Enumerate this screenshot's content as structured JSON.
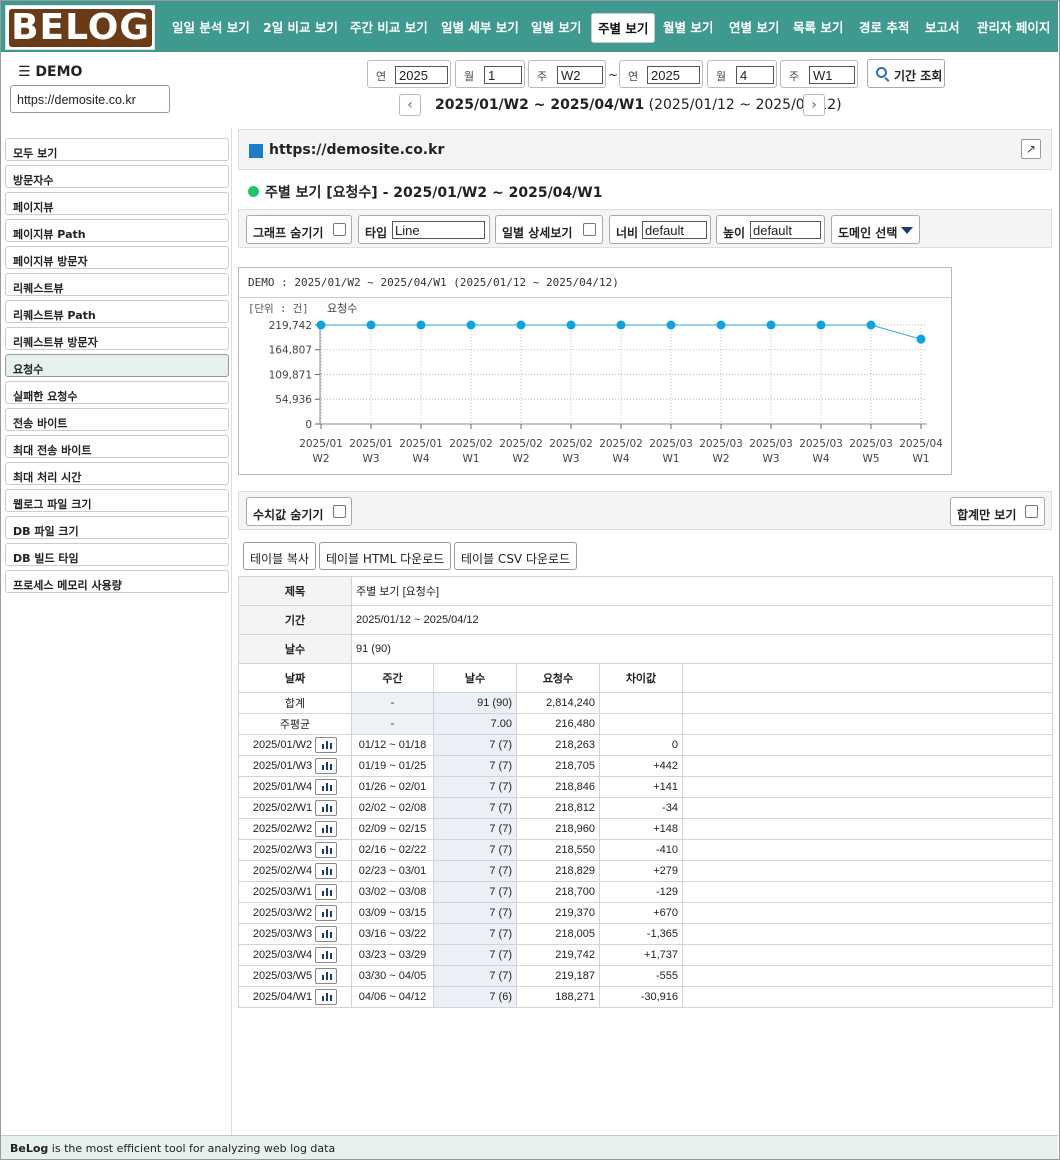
{
  "brand": "BELOG",
  "nav": [
    "일일 분석 보기",
    "2일 비교 보기",
    "주간 비교 보기",
    "일별 세부 보기",
    "일별 보기",
    "주별 보기",
    "월별 보기",
    "연별 보기",
    "목록 보기",
    "경로 추적",
    "보고서",
    "관리자 페이지"
  ],
  "nav_active": "주별 보기",
  "menu_title": "☰ DEMO",
  "site": "https://demosite.co.kr",
  "period": {
    "from_year_label": "연",
    "from_year": "2025",
    "from_month_label": "월",
    "from_month": "1",
    "from_week_label": "주",
    "from_week": "W2",
    "tilde": "~",
    "to_year_label": "연",
    "to_year": "2025",
    "to_month_label": "월",
    "to_month": "4",
    "to_week_label": "주",
    "to_week": "W1",
    "search_label": "기간 조회",
    "prev": "‹",
    "next": "›",
    "range_bold": "2025/01/W2 ~ 2025/04/W1",
    "range_dates": " (2025/01/12 ~ 2025/04/12)"
  },
  "sidebar": [
    "모두 보기",
    "방문자수",
    "페이지뷰",
    "페이지뷰 Path",
    "페이지뷰 방문자",
    "리퀘스트뷰",
    "리퀘스트뷰 Path",
    "리퀘스트뷰 방문자",
    "요청수",
    "실패한 요청수",
    "전송 바이트",
    "최대 전송 바이트",
    "최대 처리 시간",
    "웹로그 파일 크기",
    "DB 파일 크기",
    "DB 빌드 타임",
    "프로세스 메모리 사용량"
  ],
  "sidebar_active": "요청수",
  "panel_title": "https://demosite.co.kr",
  "ext_icon": "↗",
  "section_title": "주별 보기 [요청수] - 2025/01/W2 ~ 2025/04/W1",
  "options": {
    "hide_graph": "그래프 숨기기",
    "type_label": "타입",
    "type_value": "Line",
    "daily_detail": "일별 상세보기",
    "width_label": "너비",
    "width_value": "default",
    "height_label": "높이",
    "height_value": "default",
    "domain_select": "도메인 선택"
  },
  "chart_title": "DEMO : 2025/01/W2 ~ 2025/04/W1 (2025/01/12 ~ 2025/04/12)",
  "chart_data": {
    "type": "line",
    "unit_label": "[단위 : 건]",
    "series": [
      {
        "name": "요청수",
        "values": [
          219742,
          219742,
          219742,
          219742,
          219742,
          219742,
          219742,
          219742,
          219742,
          219742,
          219742,
          219742,
          188271
        ]
      }
    ],
    "categories": [
      [
        "2025/01",
        "W2"
      ],
      [
        "2025/01",
        "W3"
      ],
      [
        "2025/01",
        "W4"
      ],
      [
        "2025/02",
        "W1"
      ],
      [
        "2025/02",
        "W2"
      ],
      [
        "2025/02",
        "W3"
      ],
      [
        "2025/02",
        "W4"
      ],
      [
        "2025/03",
        "W1"
      ],
      [
        "2025/03",
        "W2"
      ],
      [
        "2025/03",
        "W3"
      ],
      [
        "2025/03",
        "W4"
      ],
      [
        "2025/03",
        "W5"
      ],
      [
        "2025/04",
        "W1"
      ]
    ],
    "yticks": [
      0,
      54936,
      109871,
      164807,
      219742
    ],
    "ytick_labels": [
      "0",
      "54,936",
      "109,871",
      "164,807",
      "219,742"
    ],
    "ylim": [
      0,
      219742
    ],
    "grid": true,
    "line_color": "#29a8df",
    "marker_color": "#0ea2df"
  },
  "table_options": {
    "hide_values": "수치값 숨기기",
    "sum_only": "합계만 보기"
  },
  "table_buttons": [
    "테이블 복사",
    "테이블 HTML 다운로드",
    "테이블 CSV 다운로드"
  ],
  "table_meta": [
    {
      "k": "제목",
      "v": "주별 보기 [요청수]"
    },
    {
      "k": "기간",
      "v": "2025/01/12 ~ 2025/04/12"
    },
    {
      "k": "날수",
      "v": "91 (90)"
    }
  ],
  "table_headers": [
    "날짜",
    "주간",
    "날수",
    "요청수",
    "차이값"
  ],
  "table_rows": [
    {
      "date": "합계",
      "week": "-",
      "days": "91 (90)",
      "count": "2,814,240",
      "diff": "",
      "summary": true
    },
    {
      "date": "주평균",
      "week": "-",
      "days": "7.00",
      "count": "216,480",
      "diff": "",
      "summary": true
    },
    {
      "date": "2025/01/W2",
      "week": "01/12 ~ 01/18",
      "days": "7 (7)",
      "count": "218,263",
      "diff": "0"
    },
    {
      "date": "2025/01/W3",
      "week": "01/19 ~ 01/25",
      "days": "7 (7)",
      "count": "218,705",
      "diff": "+442"
    },
    {
      "date": "2025/01/W4",
      "week": "01/26 ~ 02/01",
      "days": "7 (7)",
      "count": "218,846",
      "diff": "+141"
    },
    {
      "date": "2025/02/W1",
      "week": "02/02 ~ 02/08",
      "days": "7 (7)",
      "count": "218,812",
      "diff": "-34"
    },
    {
      "date": "2025/02/W2",
      "week": "02/09 ~ 02/15",
      "days": "7 (7)",
      "count": "218,960",
      "diff": "+148"
    },
    {
      "date": "2025/02/W3",
      "week": "02/16 ~ 02/22",
      "days": "7 (7)",
      "count": "218,550",
      "diff": "-410"
    },
    {
      "date": "2025/02/W4",
      "week": "02/23 ~ 03/01",
      "days": "7 (7)",
      "count": "218,829",
      "diff": "+279"
    },
    {
      "date": "2025/03/W1",
      "week": "03/02 ~ 03/08",
      "days": "7 (7)",
      "count": "218,700",
      "diff": "-129"
    },
    {
      "date": "2025/03/W2",
      "week": "03/09 ~ 03/15",
      "days": "7 (7)",
      "count": "219,370",
      "diff": "+670"
    },
    {
      "date": "2025/03/W3",
      "week": "03/16 ~ 03/22",
      "days": "7 (7)",
      "count": "218,005",
      "diff": "-1,365"
    },
    {
      "date": "2025/03/W4",
      "week": "03/23 ~ 03/29",
      "days": "7 (7)",
      "count": "219,742",
      "diff": "+1,737"
    },
    {
      "date": "2025/03/W5",
      "week": "03/30 ~ 04/05",
      "days": "7 (7)",
      "count": "219,187",
      "diff": "-555"
    },
    {
      "date": "2025/04/W1",
      "week": "04/06 ~ 04/12",
      "days": "7 (6)",
      "count": "188,271",
      "diff": "-30,916"
    }
  ],
  "footer_brand": "BeLog",
  "footer_text": " is the most efficient tool for analyzing web log data"
}
